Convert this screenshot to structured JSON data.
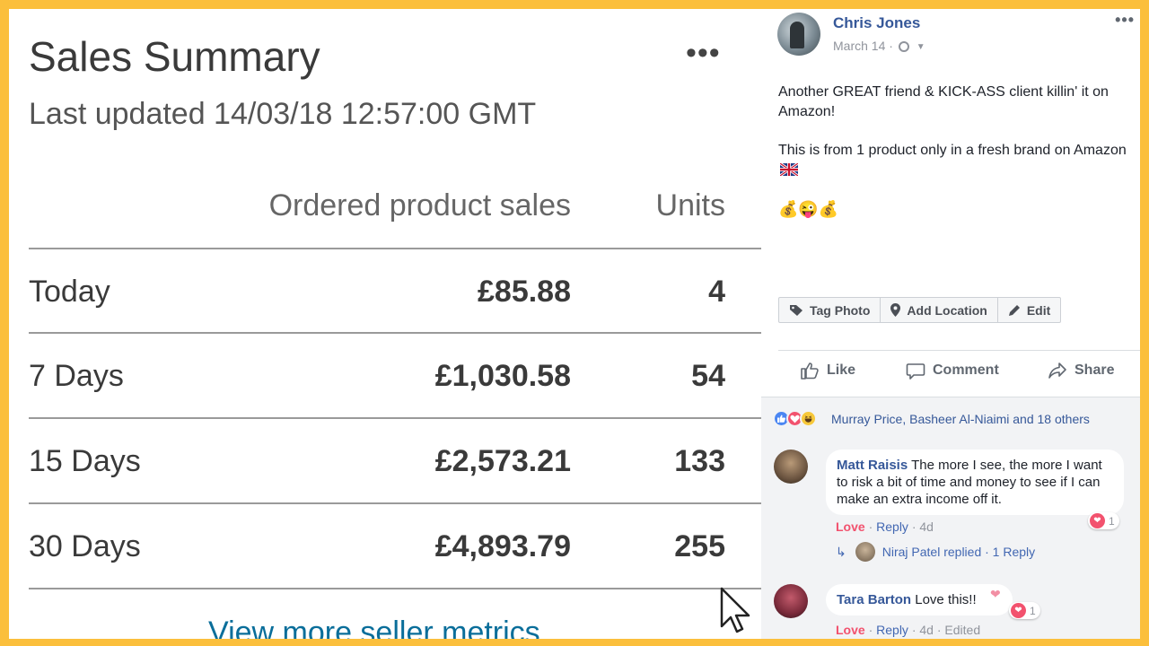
{
  "sales_summary": {
    "title": "Sales Summary",
    "more_label": "•••",
    "last_updated": "Last updated 14/03/18 12:57:00 GMT",
    "col_sales": "Ordered product sales",
    "col_units": "Units",
    "rows": [
      {
        "label": "Today",
        "sales": "£85.88",
        "units": "4"
      },
      {
        "label": "7 Days",
        "sales": "£1,030.58",
        "units": "54"
      },
      {
        "label": "15 Days",
        "sales": "£2,573.21",
        "units": "133"
      },
      {
        "label": "30 Days",
        "sales": "£4,893.79",
        "units": "255"
      }
    ],
    "view_more": "View more seller metrics"
  },
  "post": {
    "author": "Chris Jones",
    "date": "March 14 ·",
    "options": "•••",
    "text_p1": "Another GREAT friend & KICK-ASS client killin' it on Amazon!",
    "text_p2": "This is from 1 product only in a fresh brand on Amazon",
    "emojis": "💰😜💰",
    "photo_actions": {
      "tag": "Tag Photo",
      "location": "Add Location",
      "edit": "Edit"
    },
    "actions": {
      "like": "Like",
      "comment": "Comment",
      "share": "Share"
    },
    "reactors": "Murray Price, Basheer Al-Niaimi and 18 others",
    "comments": [
      {
        "name": "Matt Raisis",
        "text": "The more I see, the more I want to risk a bit of time and money to see if I can make an extra income off it.",
        "love": "Love",
        "reply": "Reply",
        "time": "4d",
        "reaction_count": "1",
        "replies_text": "Niraj Patel replied · 1 Reply"
      },
      {
        "name": "Tara Barton",
        "text": "Love this!!",
        "love": "Love",
        "reply": "Reply",
        "time": "4d",
        "edited": "Edited",
        "reaction_count": "1"
      }
    ]
  },
  "colors": {
    "frame": "#fbbf3c",
    "fb_blue": "#365899",
    "love_red": "#f2526e",
    "link_teal": "#0a6e9a"
  }
}
